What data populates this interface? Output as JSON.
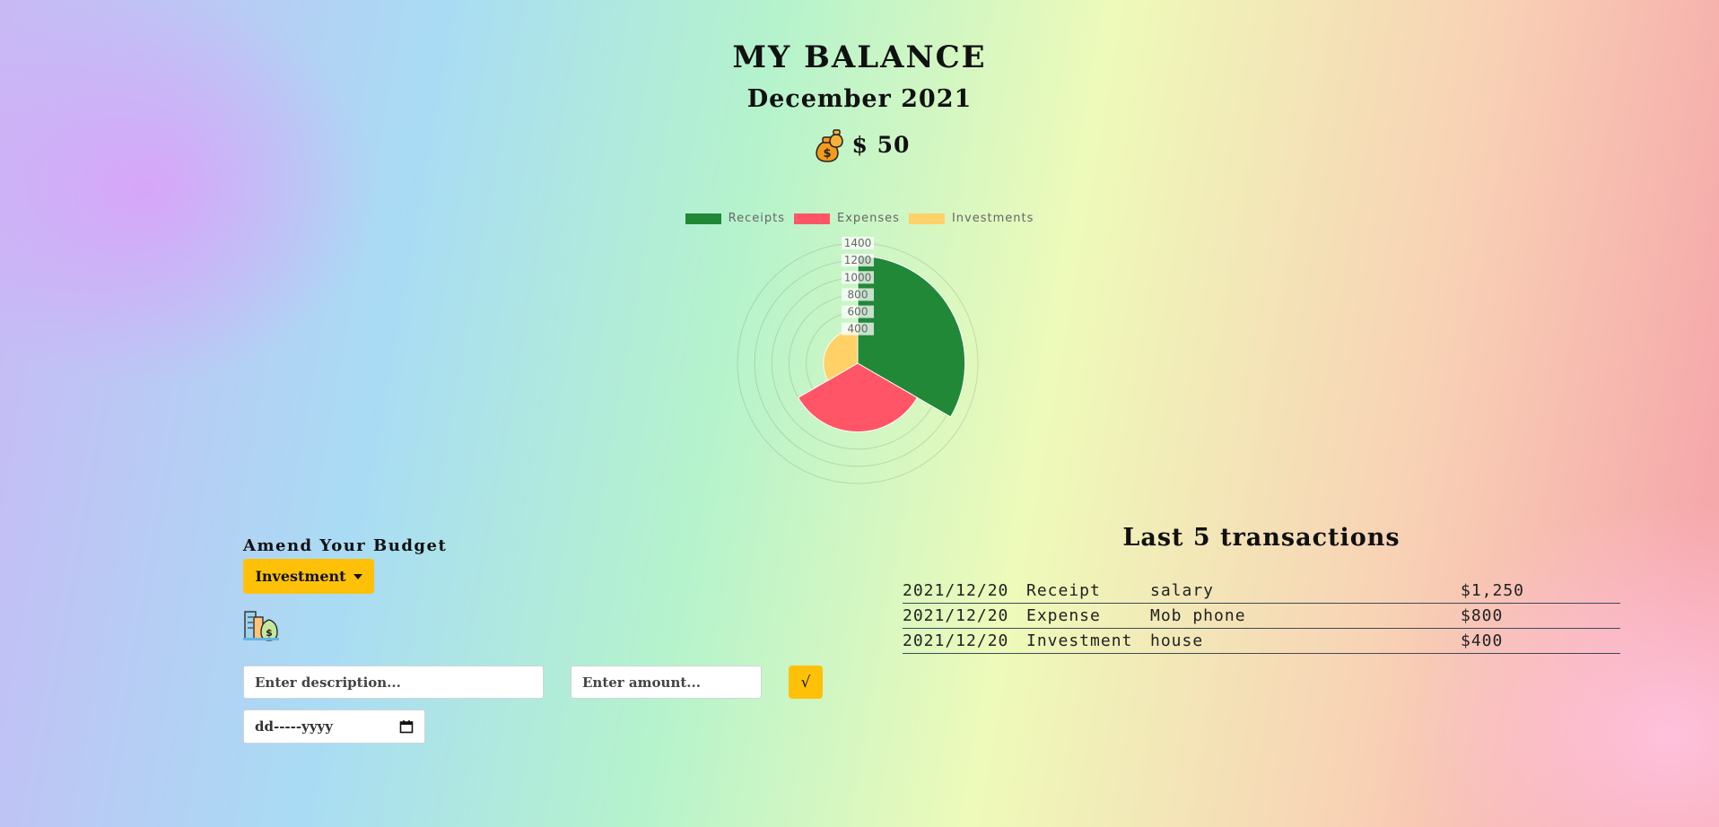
{
  "header": {
    "title": "MY BALANCE",
    "month": "December 2021",
    "balance": "$ 50",
    "balance_icon": "money-bags-icon"
  },
  "chart_data": {
    "type": "polarArea",
    "series": [
      {
        "name": "Receipts",
        "value": 1250,
        "color": "#218838"
      },
      {
        "name": "Expenses",
        "value": 800,
        "color": "#ff5566"
      },
      {
        "name": "Investments",
        "value": 400,
        "color": "#ffd166"
      }
    ],
    "r_ticks": [
      400,
      600,
      800,
      1000,
      1200,
      1400
    ],
    "r_max": 1400,
    "r_min": 0
  },
  "budget": {
    "title": "Amend Your Budget",
    "dropdown_selected": "Investment",
    "type_icon": "investment-building-icon",
    "description_placeholder": "Enter description...",
    "amount_placeholder": "Enter amount...",
    "date_placeholder": "dd-----yyyy",
    "submit_label": "√"
  },
  "transactions": {
    "title": "Last 5 transactions",
    "rows": [
      {
        "date": "2021/12/20",
        "type": "Receipt",
        "description": "salary",
        "amount": "$1,250"
      },
      {
        "date": "2021/12/20",
        "type": "Expense",
        "description": "Mob phone",
        "amount": "$800"
      },
      {
        "date": "2021/12/20",
        "type": "Investment",
        "description": "house",
        "amount": "$400"
      }
    ]
  }
}
